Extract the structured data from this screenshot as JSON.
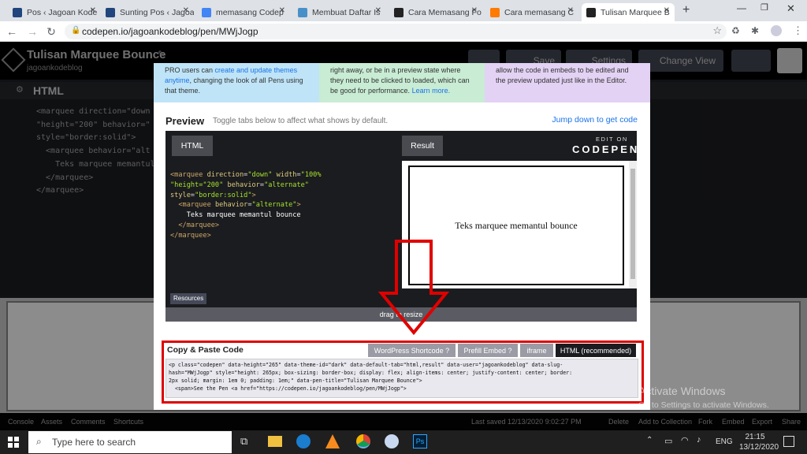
{
  "tabs": [
    {
      "label": "Pos ‹ Jagoan Kode",
      "fav_color": "#21467e"
    },
    {
      "label": "Sunting Pos ‹ Jagoa",
      "fav_color": "#21467e"
    },
    {
      "label": "memasang Codep",
      "fav_color": "#4285f4"
    },
    {
      "label": "Membuat Daftar Is",
      "fav_color": "#4a90c8"
    },
    {
      "label": "Cara Memasang Fo",
      "fav_color": "#222222"
    },
    {
      "label": "Cara memasang C",
      "fav_color": "#ff7a00"
    },
    {
      "label": "Tulisan Marquee B",
      "fav_color": "#222222"
    }
  ],
  "url": "codepen.io/jagoankodeblog/pen/MWjJogp",
  "pen": {
    "title": "Tulisan Marquee Bounce",
    "author": "jagoankodeblog"
  },
  "header_buttons": {
    "save": "Save",
    "settings": "Settings",
    "change_view": "Change View"
  },
  "editor_label": "HTML",
  "editor_code": "<marquee direction=\"down\n\"height=\"200\" behavior=\"\nstyle=\"border:solid\">\n  <marquee behavior=\"alt\n    Teks marquee memantul\n  </marquee>\n</marquee>",
  "footer": {
    "console": "Console",
    "assets": "Assets",
    "comments": "Comments",
    "shortcuts": "Shortcuts",
    "last_saved": "Last saved 12/13/2020 9:02:27 PM",
    "delete": "Delete",
    "add_collection": "Add to Collection",
    "fork": "Fork",
    "embed": "Embed",
    "export": "Export",
    "share": "Share"
  },
  "modal": {
    "info_cols": [
      {
        "text_pre": "PRO users can ",
        "link": "create and update themes anytime",
        "text_post": ", changing the look of all Pens using that theme.",
        "bg": "#bfe4f7"
      },
      {
        "text_pre": "right away, or be in a preview state where they need to be clicked to loaded, which can be good for performance. ",
        "link": "Learn more.",
        "text_post": "",
        "bg": "#c8ecd4"
      },
      {
        "text_pre": "allow the code in embeds to be edited and the preview updated just like in the Editor.",
        "link": "",
        "text_post": "",
        "bg": "#e3d2f4"
      }
    ],
    "preview_title": "Preview",
    "preview_sub": "Toggle tabs below to affect what shows by default.",
    "jump": "Jump down to get code",
    "tab_html": "HTML",
    "tab_result": "Result",
    "edit_on": "EDIT ON",
    "codepen": "CODEPEN",
    "marquee_text": "Teks marquee memantul bounce",
    "resources": "Resources",
    "drag": "drag to resize",
    "copy_title": "Copy & Paste Code",
    "copy_tabs": [
      "WordPress Shortcode ?",
      "Prefill Embed ?",
      "iframe",
      "HTML (recommended)"
    ],
    "code_lines": [
      "<p class=\"codepen\" data-height=\"265\" data-theme-id=\"dark\" data-default-tab=\"html,result\" data-user=\"jagoankodeblog\" data-slug-",
      "hash=\"MWjJogp\" style=\"height: 265px; box-sizing: border-box; display: flex; align-items: center; justify-content: center; border:",
      "2px solid; margin: 1em 0; padding: 1em;\" data-pen-title=\"Tulisan Marquee Bounce\">",
      "  <span>See the Pen <a href=\"https://codepen.io/jagoankodeblog/pen/MWjJogp\">"
    ]
  },
  "windows_activation": {
    "title": "Activate Windows",
    "sub": "Go to Settings to activate Windows."
  },
  "taskbar": {
    "search": "Type here to search",
    "lang": "ENG",
    "time": "21:15",
    "date": "13/12/2020"
  }
}
